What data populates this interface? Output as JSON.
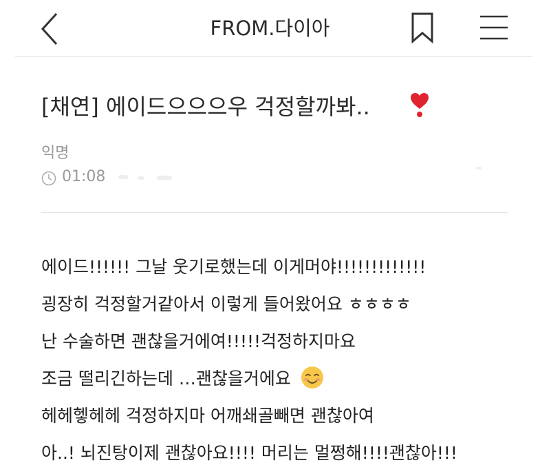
{
  "header": {
    "title": "FROM.다이아",
    "back_icon": "chevron-left-icon",
    "bookmark_icon": "bookmark-icon",
    "menu_icon": "hamburger-menu-icon"
  },
  "post": {
    "title": "[채연] 에이드으으으우 걱정할까봐..",
    "title_emoji": "heart-exclamation-icon",
    "author": "익명",
    "time": "01:08"
  },
  "body": {
    "lines": [
      "에이드!!!!!! 그날 웃기로했는데 이게머야!!!!!!!!!!!!!",
      "굉장히 걱정할거같아서 이렇게 들어왔어요 ㅎㅎㅎㅎ",
      "난 수술하면 괜찮을거에여!!!!!걱정하지마요",
      "조금 떨리긴하는데 …괜찮을거에요",
      "헤헤헿헤헤 걱정하지마 어깨쇄골빼면 괜찮아여",
      "아..! 뇌진탕이제 괜찮아요!!!! 머리는 멀쩡해!!!!괜찮아!!!"
    ],
    "line4_emoji": "smiling-face-icon"
  },
  "colors": {
    "text": "#222222",
    "meta": "#999999",
    "divider": "#dddddd",
    "heart": "#e0242f",
    "smile": "#f6c74a"
  }
}
